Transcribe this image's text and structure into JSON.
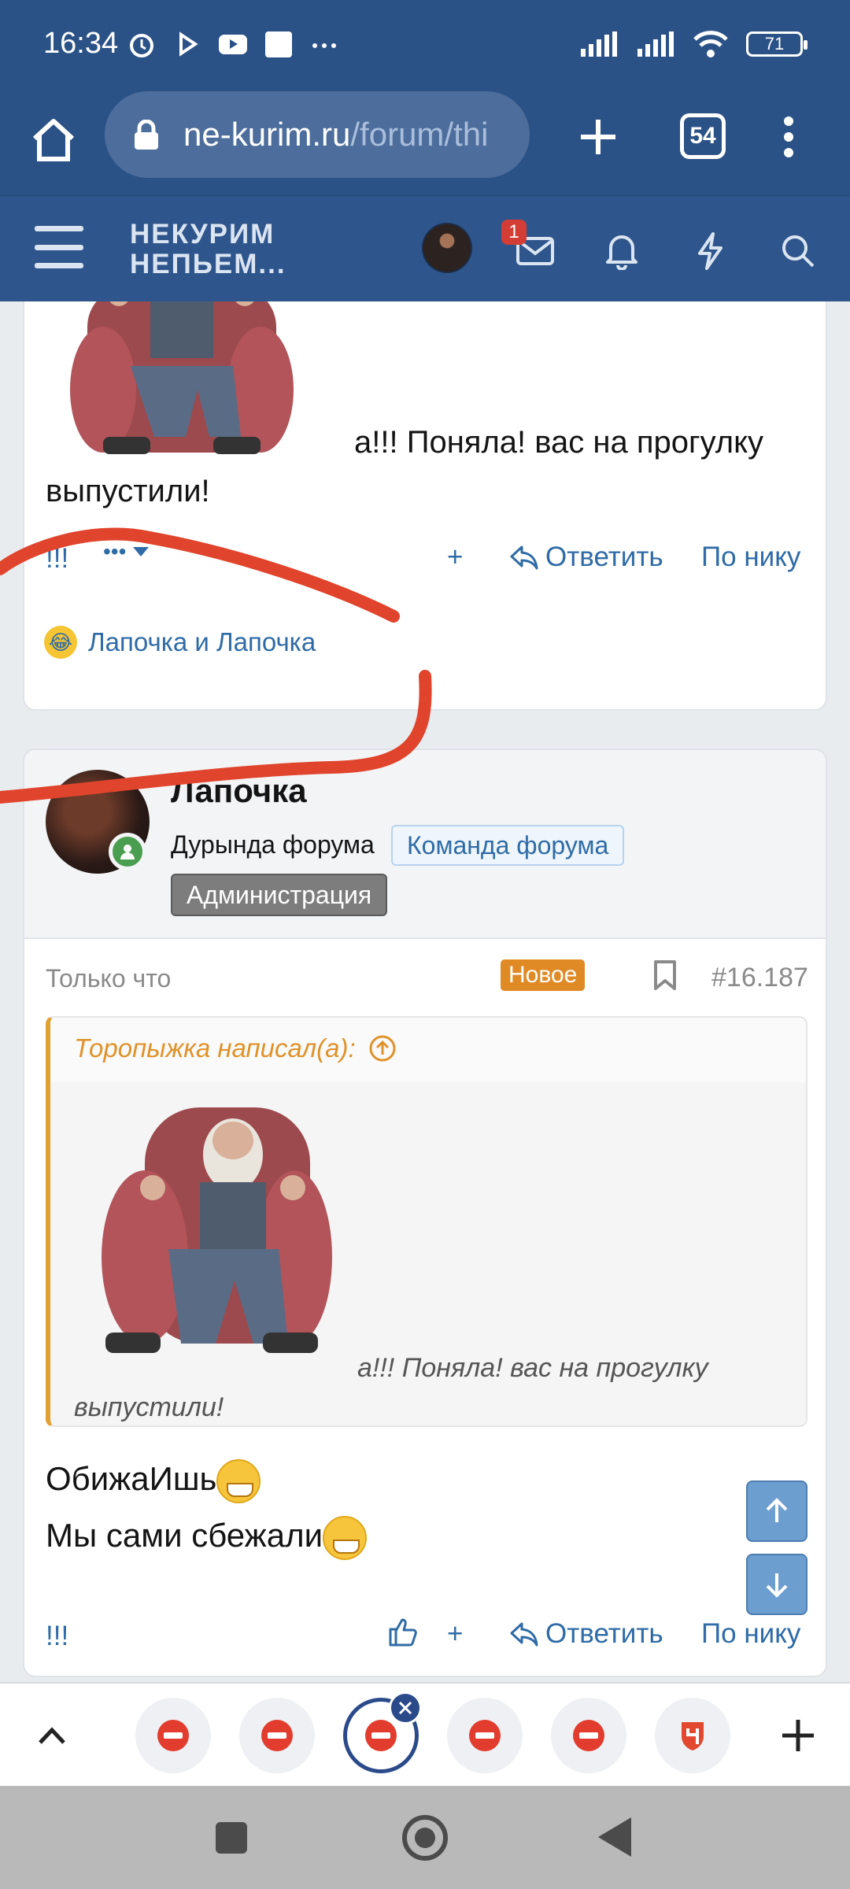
{
  "status_bar": {
    "time": "16:34",
    "battery": "71",
    "icons": [
      "alarm-icon",
      "play-icon",
      "youtube-icon",
      "app-icon",
      "more-icon",
      "signal-icon",
      "signal-icon",
      "wifi-icon",
      "battery-icon"
    ]
  },
  "browser": {
    "url_host": "ne-kurim.ru",
    "url_path": "/forum/thi",
    "tab_count": "54"
  },
  "site_header": {
    "logo_line1": "НЕКУРИМ",
    "logo_line2": "НЕПЬЕМ...",
    "inbox_badge": "1"
  },
  "post1": {
    "text": "а!!! Поняла! вас на прогулку выпустили!",
    "actions": {
      "marks": "!!!",
      "more": "•••",
      "plus": "+",
      "reply": "Ответить",
      "by_nick": "По нику"
    },
    "reactions": "Лапочка и Лапочка"
  },
  "post2": {
    "username": "Лапочка",
    "user_title": "Дурында форума",
    "banner_team": "Команда форума",
    "banner_admin": "Администрация",
    "time": "Только что",
    "new_badge": "Новое",
    "post_number": "#16.187",
    "quote": {
      "author": "Торопыжка написал(а):",
      "text": "а!!! Поняла! вас на прогулку выпустили!"
    },
    "reply_line1": "ОбижаИшь",
    "reply_line2": "Мы сами сбежали",
    "actions": {
      "marks": "!!!",
      "plus": "+",
      "reply": "Ответить",
      "by_nick": "По нику"
    }
  },
  "colors": {
    "header_bg": "#2b5287",
    "link": "#2f6ba6",
    "quote_accent": "#e3a032",
    "new_badge": "#e08a25",
    "annotation_red": "#e0442c"
  }
}
